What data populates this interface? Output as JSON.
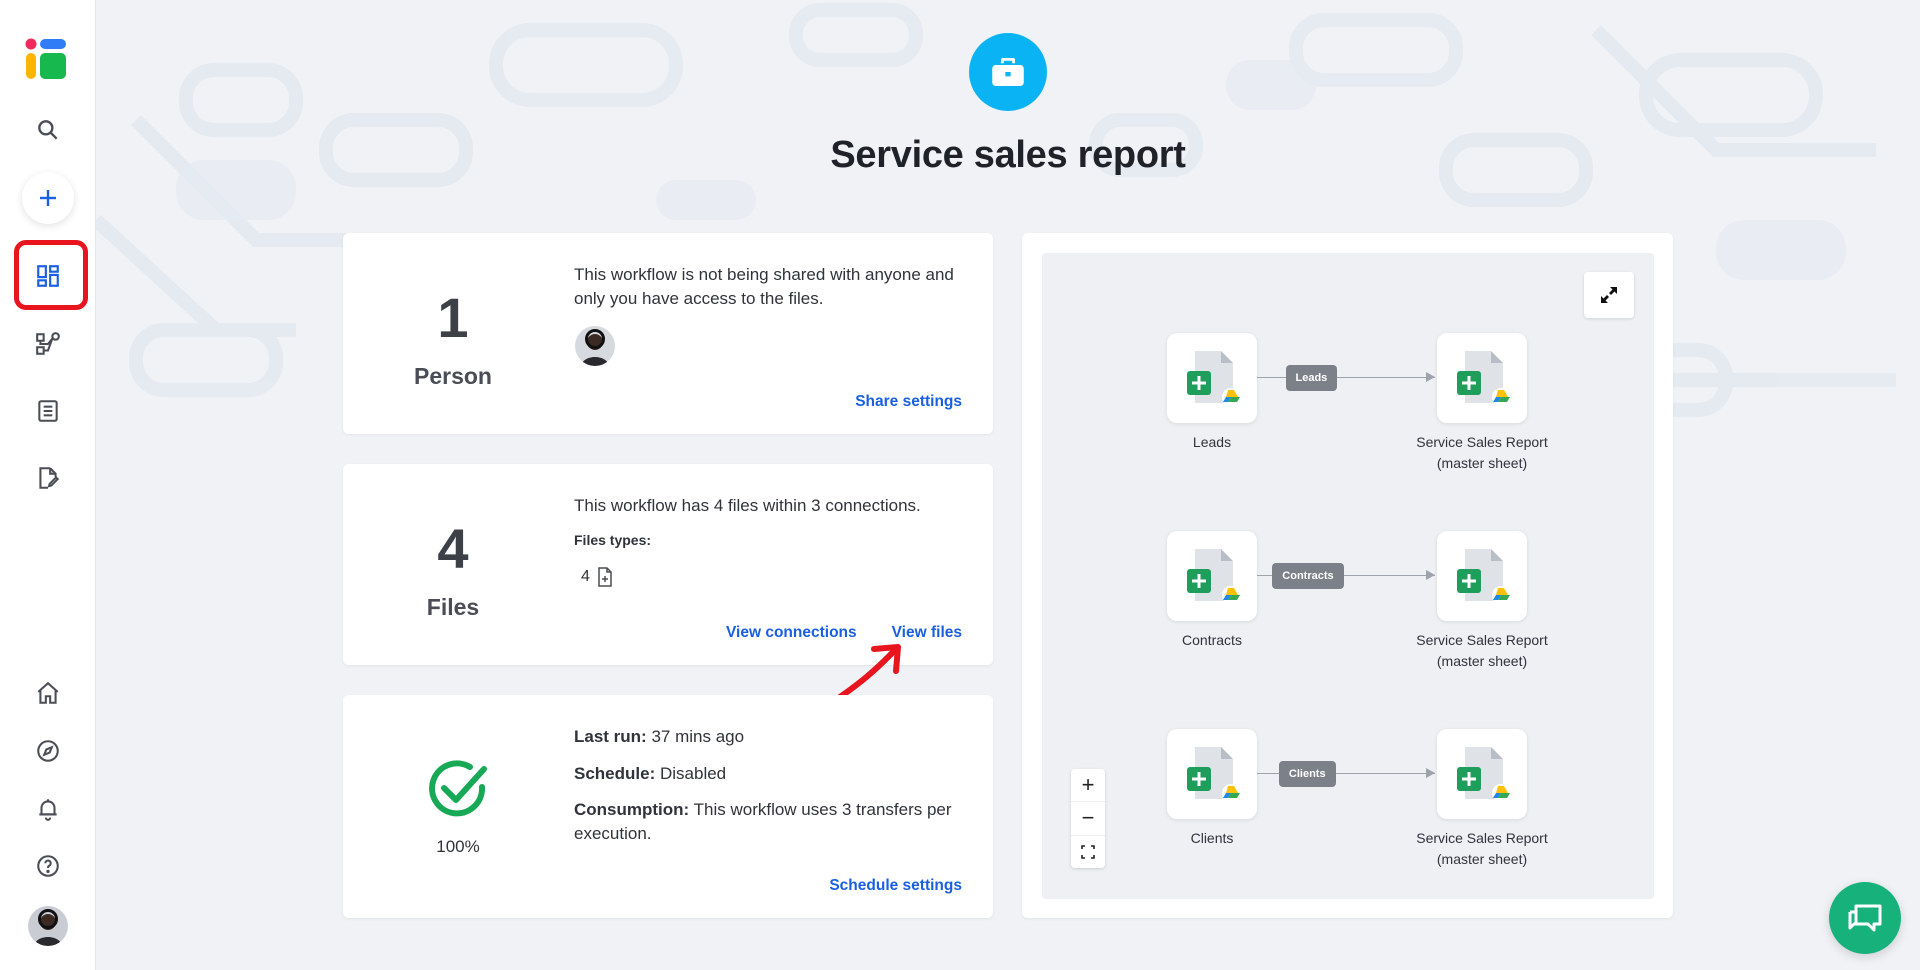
{
  "page": {
    "title": "Service sales report"
  },
  "sidebar": {
    "items": [
      {
        "name": "search",
        "icon": "search-icon"
      },
      {
        "name": "add",
        "icon": "plus-icon"
      },
      {
        "name": "dashboard",
        "icon": "dashboard-icon",
        "active": true
      },
      {
        "name": "workflows",
        "icon": "workflow-icon"
      },
      {
        "name": "logs",
        "icon": "document-list-icon"
      },
      {
        "name": "templates",
        "icon": "edit-document-icon"
      },
      {
        "name": "home",
        "icon": "home-icon"
      },
      {
        "name": "explore",
        "icon": "compass-icon"
      },
      {
        "name": "notifications",
        "icon": "bell-icon"
      },
      {
        "name": "help",
        "icon": "help-icon"
      },
      {
        "name": "profile",
        "icon": "avatar"
      }
    ],
    "accent_color": "#1a5fe0"
  },
  "sharing_card": {
    "number": "1",
    "label": "Person",
    "description": "This workflow is not being shared with anyone and only you have access to the files.",
    "link": "Share settings"
  },
  "files_card": {
    "number": "4",
    "label": "Files",
    "description": "This workflow has 4 files within 3 connections.",
    "types_label": "Files types:",
    "type_count": "4",
    "link_connections": "View connections",
    "link_files": "View files"
  },
  "status_card": {
    "percent": "100%",
    "last_run_label": "Last run:",
    "last_run_value": "37 mins ago",
    "schedule_label": "Schedule:",
    "schedule_value": "Disabled",
    "consumption_label": "Consumption:",
    "consumption_value": "This workflow uses 3 transfers per execution.",
    "link": "Schedule settings",
    "status_color": "#18a957"
  },
  "diagram": {
    "connections": [
      {
        "source": "Leads",
        "badge": "Leads",
        "target_line1": "Service Sales Report",
        "target_line2": "(master sheet)"
      },
      {
        "source": "Contracts",
        "badge": "Contracts",
        "target_line1": "Service Sales Report",
        "target_line2": "(master sheet)"
      },
      {
        "source": "Clients",
        "badge": "Clients",
        "target_line1": "Service Sales Report",
        "target_line2": "(master sheet)"
      }
    ],
    "zoom_in": "+",
    "zoom_out": "−"
  },
  "colors": {
    "hero_icon": "#0ab4f4",
    "link": "#1a5fe0",
    "chat": "#17b17c",
    "sheets_green": "#1e9e5a",
    "annotation_red": "#e8141e"
  }
}
